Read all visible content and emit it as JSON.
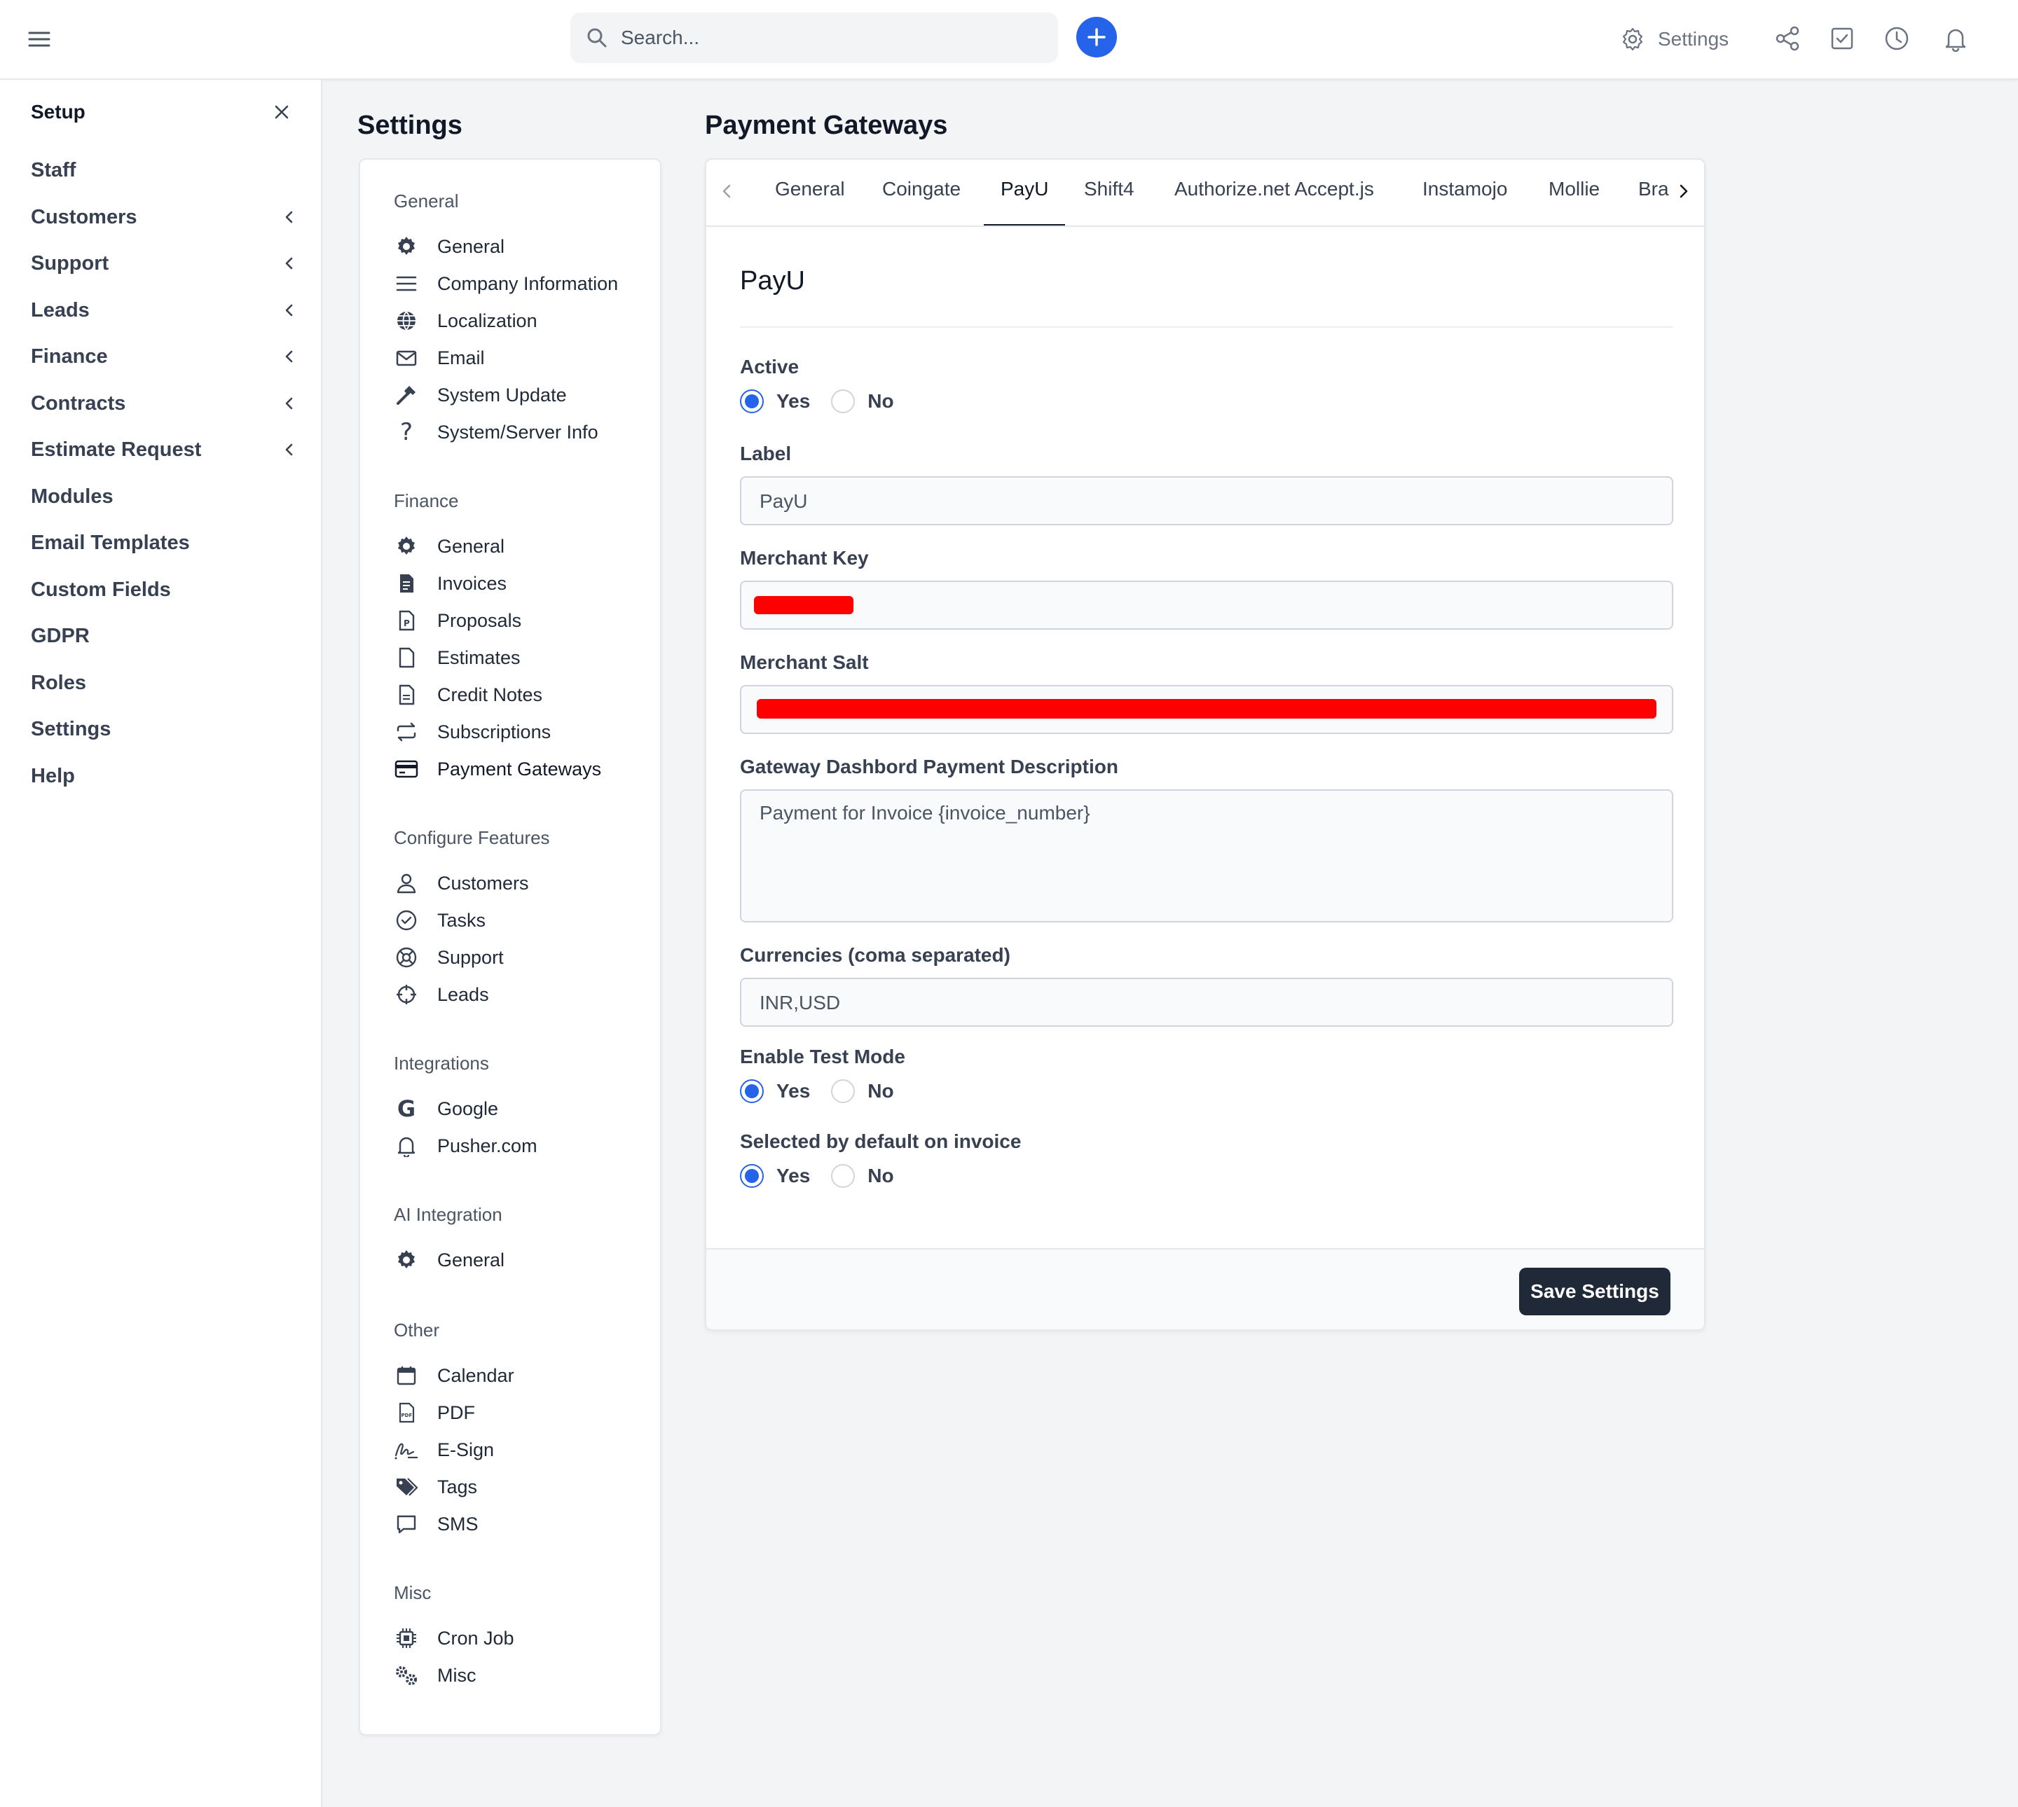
{
  "topbar": {
    "search_placeholder": "Search...",
    "settings_label": "Settings",
    "icons": [
      "menu-icon",
      "search-icon",
      "plus-icon",
      "gear-icon",
      "share-icon",
      "checkbox-icon",
      "clock-icon",
      "bell-icon"
    ]
  },
  "sidebar": {
    "title": "Setup",
    "items": [
      {
        "label": "Staff",
        "has_children": false
      },
      {
        "label": "Customers",
        "has_children": true
      },
      {
        "label": "Support",
        "has_children": true
      },
      {
        "label": "Leads",
        "has_children": true
      },
      {
        "label": "Finance",
        "has_children": true
      },
      {
        "label": "Contracts",
        "has_children": true
      },
      {
        "label": "Estimate Request",
        "has_children": true
      },
      {
        "label": "Modules",
        "has_children": false
      },
      {
        "label": "Email Templates",
        "has_children": false
      },
      {
        "label": "Custom Fields",
        "has_children": false
      },
      {
        "label": "GDPR",
        "has_children": false
      },
      {
        "label": "Roles",
        "has_children": false
      },
      {
        "label": "Settings",
        "has_children": false
      },
      {
        "label": "Help",
        "has_children": false
      }
    ]
  },
  "settings": {
    "title": "Settings",
    "groups": {
      "general": {
        "title": "General",
        "items": [
          "General",
          "Company Information",
          "Localization",
          "Email",
          "System Update",
          "System/Server Info"
        ]
      },
      "finance": {
        "title": "Finance",
        "items": [
          "General",
          "Invoices",
          "Proposals",
          "Estimates",
          "Credit Notes",
          "Subscriptions",
          "Payment Gateways"
        ]
      },
      "features": {
        "title": "Configure Features",
        "items": [
          "Customers",
          "Tasks",
          "Support",
          "Leads"
        ]
      },
      "integrations": {
        "title": "Integrations",
        "items": [
          "Google",
          "Pusher.com"
        ]
      },
      "ai": {
        "title": "AI Integration",
        "items": [
          "General"
        ]
      },
      "other": {
        "title": "Other",
        "items": [
          "Calendar",
          "PDF",
          "E-Sign",
          "Tags",
          "SMS"
        ]
      },
      "misc": {
        "title": "Misc",
        "items": [
          "Cron Job",
          "Misc"
        ]
      }
    },
    "active_item": "Payment Gateways"
  },
  "gateways": {
    "title": "Payment Gateways",
    "tabs": [
      "General",
      "Coingate",
      "PayU",
      "Shift4",
      "Authorize.net Accept.js",
      "Instamojo",
      "Mollie",
      "Bra"
    ],
    "active_tab": "PayU",
    "form": {
      "gateway_name": "PayU",
      "active_label": "Active",
      "yes": "Yes",
      "no": "No",
      "active_value": "Yes",
      "label_label": "Label",
      "label_value": "PayU",
      "merchant_key_label": "Merchant Key",
      "merchant_salt_label": "Merchant Salt",
      "description_label": "Gateway Dashbord Payment Description",
      "description_value": "Payment for Invoice {invoice_number}",
      "currencies_label": "Currencies (coma separated)",
      "currencies_value": "INR,USD",
      "test_mode_label": "Enable Test Mode",
      "test_mode_value": "Yes",
      "default_label": "Selected by default on invoice",
      "default_value": "Yes",
      "save_label": "Save Settings"
    },
    "colors": {
      "accent": "#2563eb",
      "redaction": "#ff0000",
      "primary_button": "#1f2937"
    }
  }
}
